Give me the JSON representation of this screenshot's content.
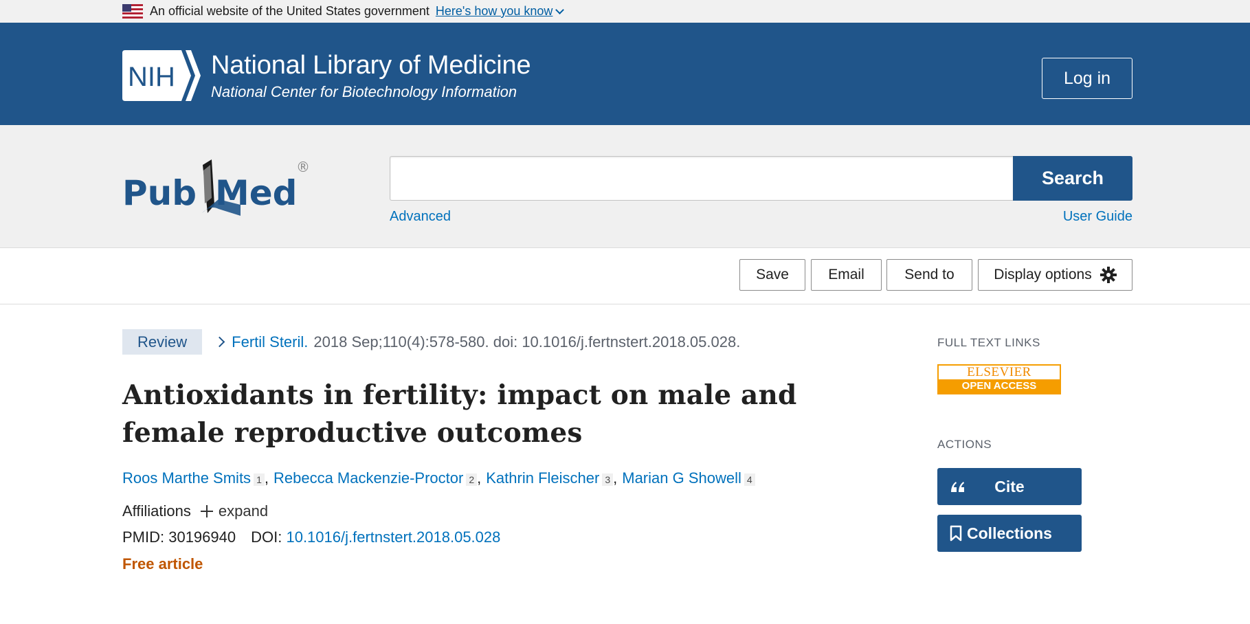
{
  "gov_banner": {
    "text": "An official website of the United States government",
    "link": "Here's how you know"
  },
  "nih_header": {
    "logo_text": "NIH",
    "title": "National Library of Medicine",
    "subtitle": "National Center for Biotechnology Information",
    "login_label": "Log in"
  },
  "search": {
    "logo_pub": "Pub",
    "logo_med": "Med",
    "logo_reg": "®",
    "value": "",
    "button_label": "Search",
    "advanced_label": "Advanced",
    "user_guide_label": "User Guide"
  },
  "toolbar": {
    "save_label": "Save",
    "email_label": "Email",
    "send_to_label": "Send to",
    "display_options_label": "Display options"
  },
  "article": {
    "type_badge": "Review",
    "journal": "Fertil Steril.",
    "citation": "2018 Sep;110(4):578-580. doi: 10.1016/j.fertnstert.2018.05.028.",
    "title": "Antioxidants in fertility: impact on male and female reproductive outcomes",
    "authors": [
      {
        "name": "Roos Marthe Smits",
        "aff": "1"
      },
      {
        "name": "Rebecca Mackenzie-Proctor",
        "aff": "2"
      },
      {
        "name": "Kathrin Fleischer",
        "aff": "3"
      },
      {
        "name": "Marian G Showell",
        "aff": "4"
      }
    ],
    "affiliations_label": "Affiliations",
    "expand_label": "expand",
    "pmid_label": "PMID: 30196940",
    "doi_label": "DOI:",
    "doi_value": "10.1016/j.fertnstert.2018.05.028",
    "free_label": "Free article"
  },
  "sidebar": {
    "full_text_heading": "FULL TEXT LINKS",
    "elsevier_top": "ELSEVIER",
    "elsevier_bottom": "OPEN ACCESS",
    "actions_heading": "ACTIONS",
    "cite_label": "Cite",
    "collections_label": "Collections"
  },
  "colors": {
    "header_blue": "#20558a",
    "link_blue": "#0071bc",
    "free_orange": "#c05600",
    "elsevier_orange": "#f59d00"
  }
}
